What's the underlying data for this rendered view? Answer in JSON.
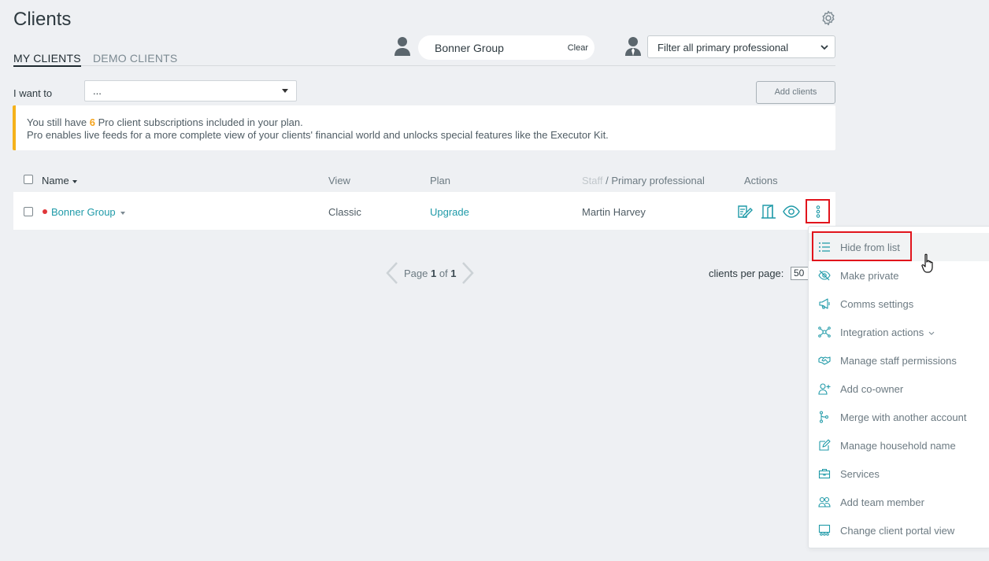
{
  "header": {
    "title": "Clients"
  },
  "tabs": [
    {
      "label": "MY CLIENTS",
      "active": true
    },
    {
      "label": "DEMO CLIENTS",
      "active": false
    }
  ],
  "client_filter": {
    "value": "Bonner Group",
    "clear_label": "Clear"
  },
  "professional_filter": {
    "value": "Filter all primary professional"
  },
  "actions_bar": {
    "i_want_to_label": "I want to",
    "i_want_to_value": "...",
    "add_clients_label": "Add clients"
  },
  "banner": {
    "line1_before": "You still have ",
    "line1_count": "6",
    "line1_after": " Pro client subscriptions included in your plan.",
    "line2": "Pro enables live feeds for a more complete view of your clients' financial world and unlocks special features like the Executor Kit."
  },
  "table": {
    "headers": {
      "name": "Name",
      "view": "View",
      "plan": "Plan",
      "staff": "Staff",
      "primary": " / Primary professional",
      "actions": "Actions"
    },
    "rows": [
      {
        "name": "Bonner Group",
        "view": "Classic",
        "plan": "Upgrade",
        "professional": "Martin Harvey"
      }
    ]
  },
  "pagination": {
    "page_word": "Page ",
    "current": "1",
    "of_word": " of ",
    "total": "1",
    "per_page_label": "clients per page:",
    "per_page_value": "50"
  },
  "context_menu": {
    "items": [
      {
        "label": "Hide from list",
        "icon": "list-icon"
      },
      {
        "label": "Make private",
        "icon": "eye-slash-icon"
      },
      {
        "label": "Comms settings",
        "icon": "megaphone-icon"
      },
      {
        "label": "Integration actions",
        "icon": "network-icon"
      },
      {
        "label": "Manage staff permissions",
        "icon": "handshake-icon"
      },
      {
        "label": "Add co-owner",
        "icon": "user-plus-icon"
      },
      {
        "label": "Merge with another account",
        "icon": "merge-icon"
      },
      {
        "label": "Manage household name",
        "icon": "edit-icon"
      },
      {
        "label": "Services",
        "icon": "briefcase-icon"
      },
      {
        "label": "Add team member",
        "icon": "users-icon"
      },
      {
        "label": "Change client portal view",
        "icon": "portal-icon"
      }
    ]
  },
  "colors": {
    "accent": "#1f9aa8",
    "warning": "#f5b21b",
    "highlight": "#e1141c"
  }
}
